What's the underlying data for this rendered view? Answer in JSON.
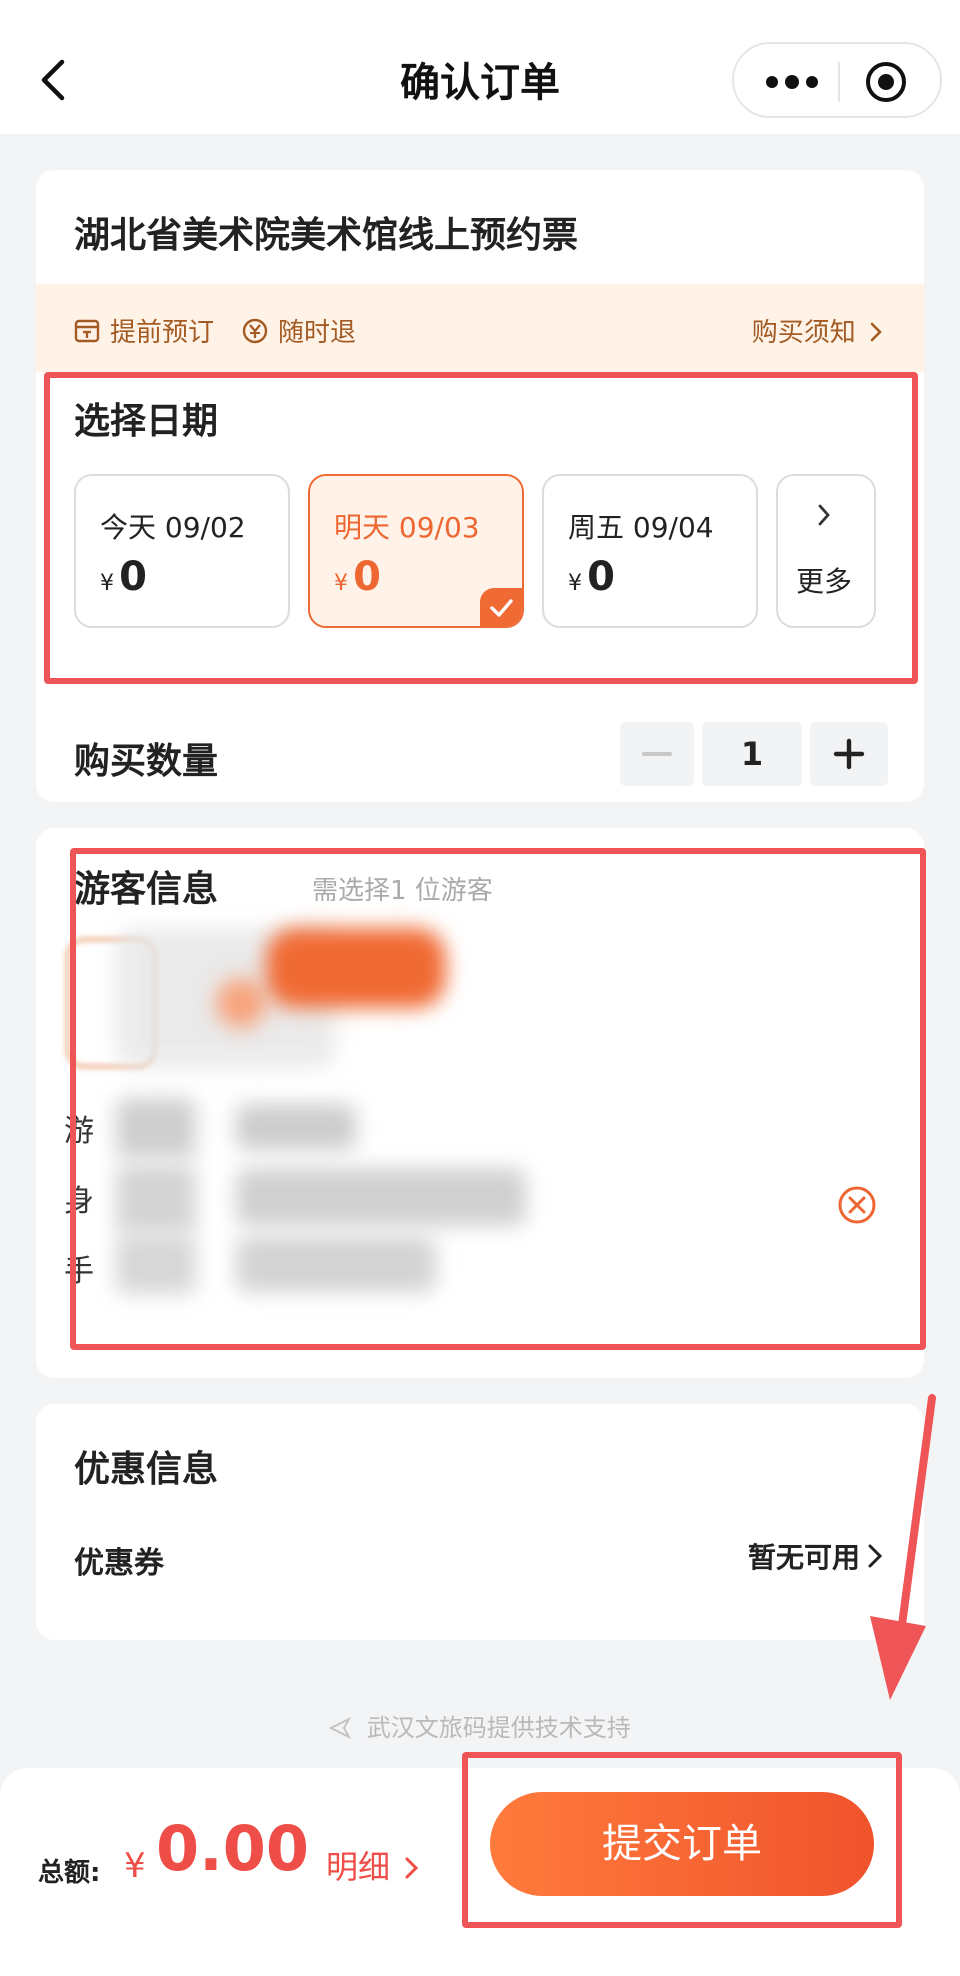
{
  "header": {
    "title": "确认订单",
    "back_icon": "chevron-left-icon",
    "more_icon": "more-dots-icon",
    "close_icon": "target-circle-icon"
  },
  "ticket": {
    "name": "湖北省美术院美术馆线上预约票",
    "notices": [
      {
        "label": "提前预订",
        "icon": "calendar-icon"
      },
      {
        "label": "随时退",
        "icon": "refund-icon"
      }
    ],
    "purchase_notice": "购买须知"
  },
  "date_section": {
    "title": "选择日期",
    "dates": [
      {
        "label": "今天 09/02",
        "currency": "¥",
        "price": "0",
        "selected": false
      },
      {
        "label": "明天 09/03",
        "currency": "¥",
        "price": "0",
        "selected": true
      },
      {
        "label": "周五 09/04",
        "currency": "¥",
        "price": "0",
        "selected": false
      }
    ],
    "more_label": "更多"
  },
  "quantity": {
    "label": "购买数量",
    "value": "1"
  },
  "visitor": {
    "title": "游客信息",
    "hint": "需选择1 位游客",
    "row_chars": [
      "游",
      "身",
      "手"
    ]
  },
  "discount": {
    "title": "优惠信息",
    "coupon_label": "优惠券",
    "coupon_value": "暂无可用"
  },
  "support_text": "武汉文旅码提供技术支持",
  "bottom": {
    "total_label": "总额:",
    "currency": "¥",
    "total_amount": "0.00",
    "detail_label": "明细",
    "submit_label": "提交订单"
  },
  "colors": {
    "accent": "#f06a33",
    "price": "#ee4e47",
    "notice_bg": "#fff3e7",
    "highlight": "#ef5457"
  }
}
